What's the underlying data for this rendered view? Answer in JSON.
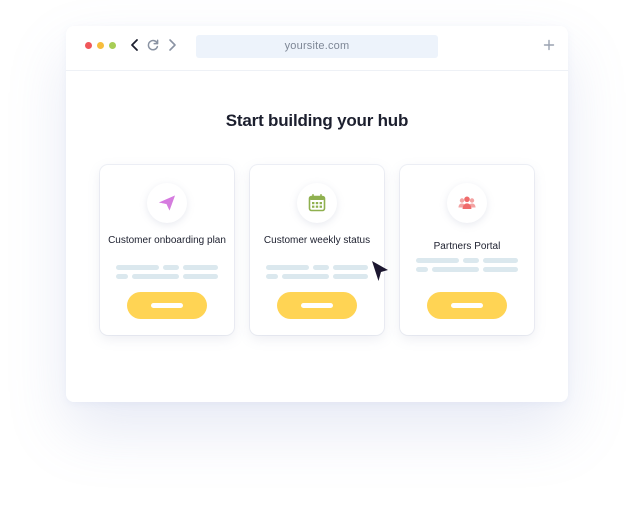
{
  "browser": {
    "url": "yoursite.com",
    "dots": [
      "#f0575a",
      "#f7bd3c",
      "#a7cd55"
    ],
    "icons": {
      "back": "chevron-left-icon",
      "reload": "reload-icon",
      "forward": "chevron-right-icon",
      "new_tab": "plus-icon"
    }
  },
  "page": {
    "title": "Start building your hub"
  },
  "cards": [
    {
      "title": "Customer onboarding plan",
      "icon": "paper-plane-icon",
      "icon_color": "#d67ae0"
    },
    {
      "title": "Customer weekly status",
      "icon": "calendar-icon",
      "icon_color": "#8fb04f"
    },
    {
      "title": "Partners Portal",
      "icon": "people-icon",
      "icon_color": "#ef6b6b"
    }
  ],
  "colors": {
    "button": "#ffd454",
    "placeholder_line": "#dbe8ee",
    "cursor": "#1c1730"
  }
}
